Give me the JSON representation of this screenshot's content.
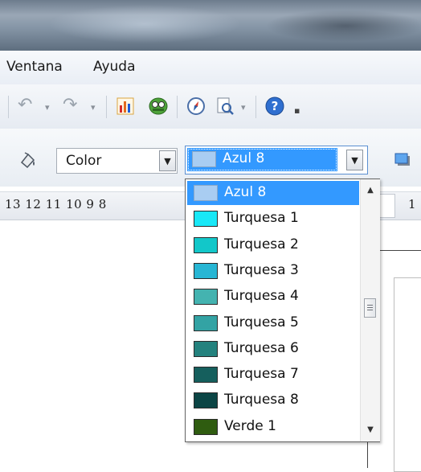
{
  "menubar": {
    "items": [
      {
        "label": "Ventana"
      },
      {
        "label": "Ayuda"
      }
    ]
  },
  "toolbar": {
    "icons": [
      "undo-icon",
      "redo-icon",
      "chart-icon",
      "bibliography-icon",
      "navigator-icon",
      "zoom-icon",
      "help-icon"
    ]
  },
  "area_toolbar": {
    "fill_style": "Color",
    "fill_color": "Azul 8"
  },
  "ruler": {
    "numbers": "13 12 11 10 9 8",
    "right_number": "1"
  },
  "color_list": [
    {
      "label": "Azul 8",
      "color": "#a9cdf2",
      "selected": true
    },
    {
      "label": "Turquesa 1",
      "color": "#19e8f7",
      "selected": false
    },
    {
      "label": "Turquesa 2",
      "color": "#12c7c9",
      "selected": false
    },
    {
      "label": "Turquesa 3",
      "color": "#27b6d4",
      "selected": false
    },
    {
      "label": "Turquesa 4",
      "color": "#44b3b0",
      "selected": false
    },
    {
      "label": "Turquesa 5",
      "color": "#33a3a4",
      "selected": false
    },
    {
      "label": "Turquesa 6",
      "color": "#24827e",
      "selected": false
    },
    {
      "label": "Turquesa 7",
      "color": "#155f5d",
      "selected": false
    },
    {
      "label": "Turquesa 8",
      "color": "#0b4545",
      "selected": false
    },
    {
      "label": "Verde 1",
      "color": "#2f5c10",
      "selected": false
    }
  ],
  "colors": {
    "selection": "#3399ff"
  }
}
